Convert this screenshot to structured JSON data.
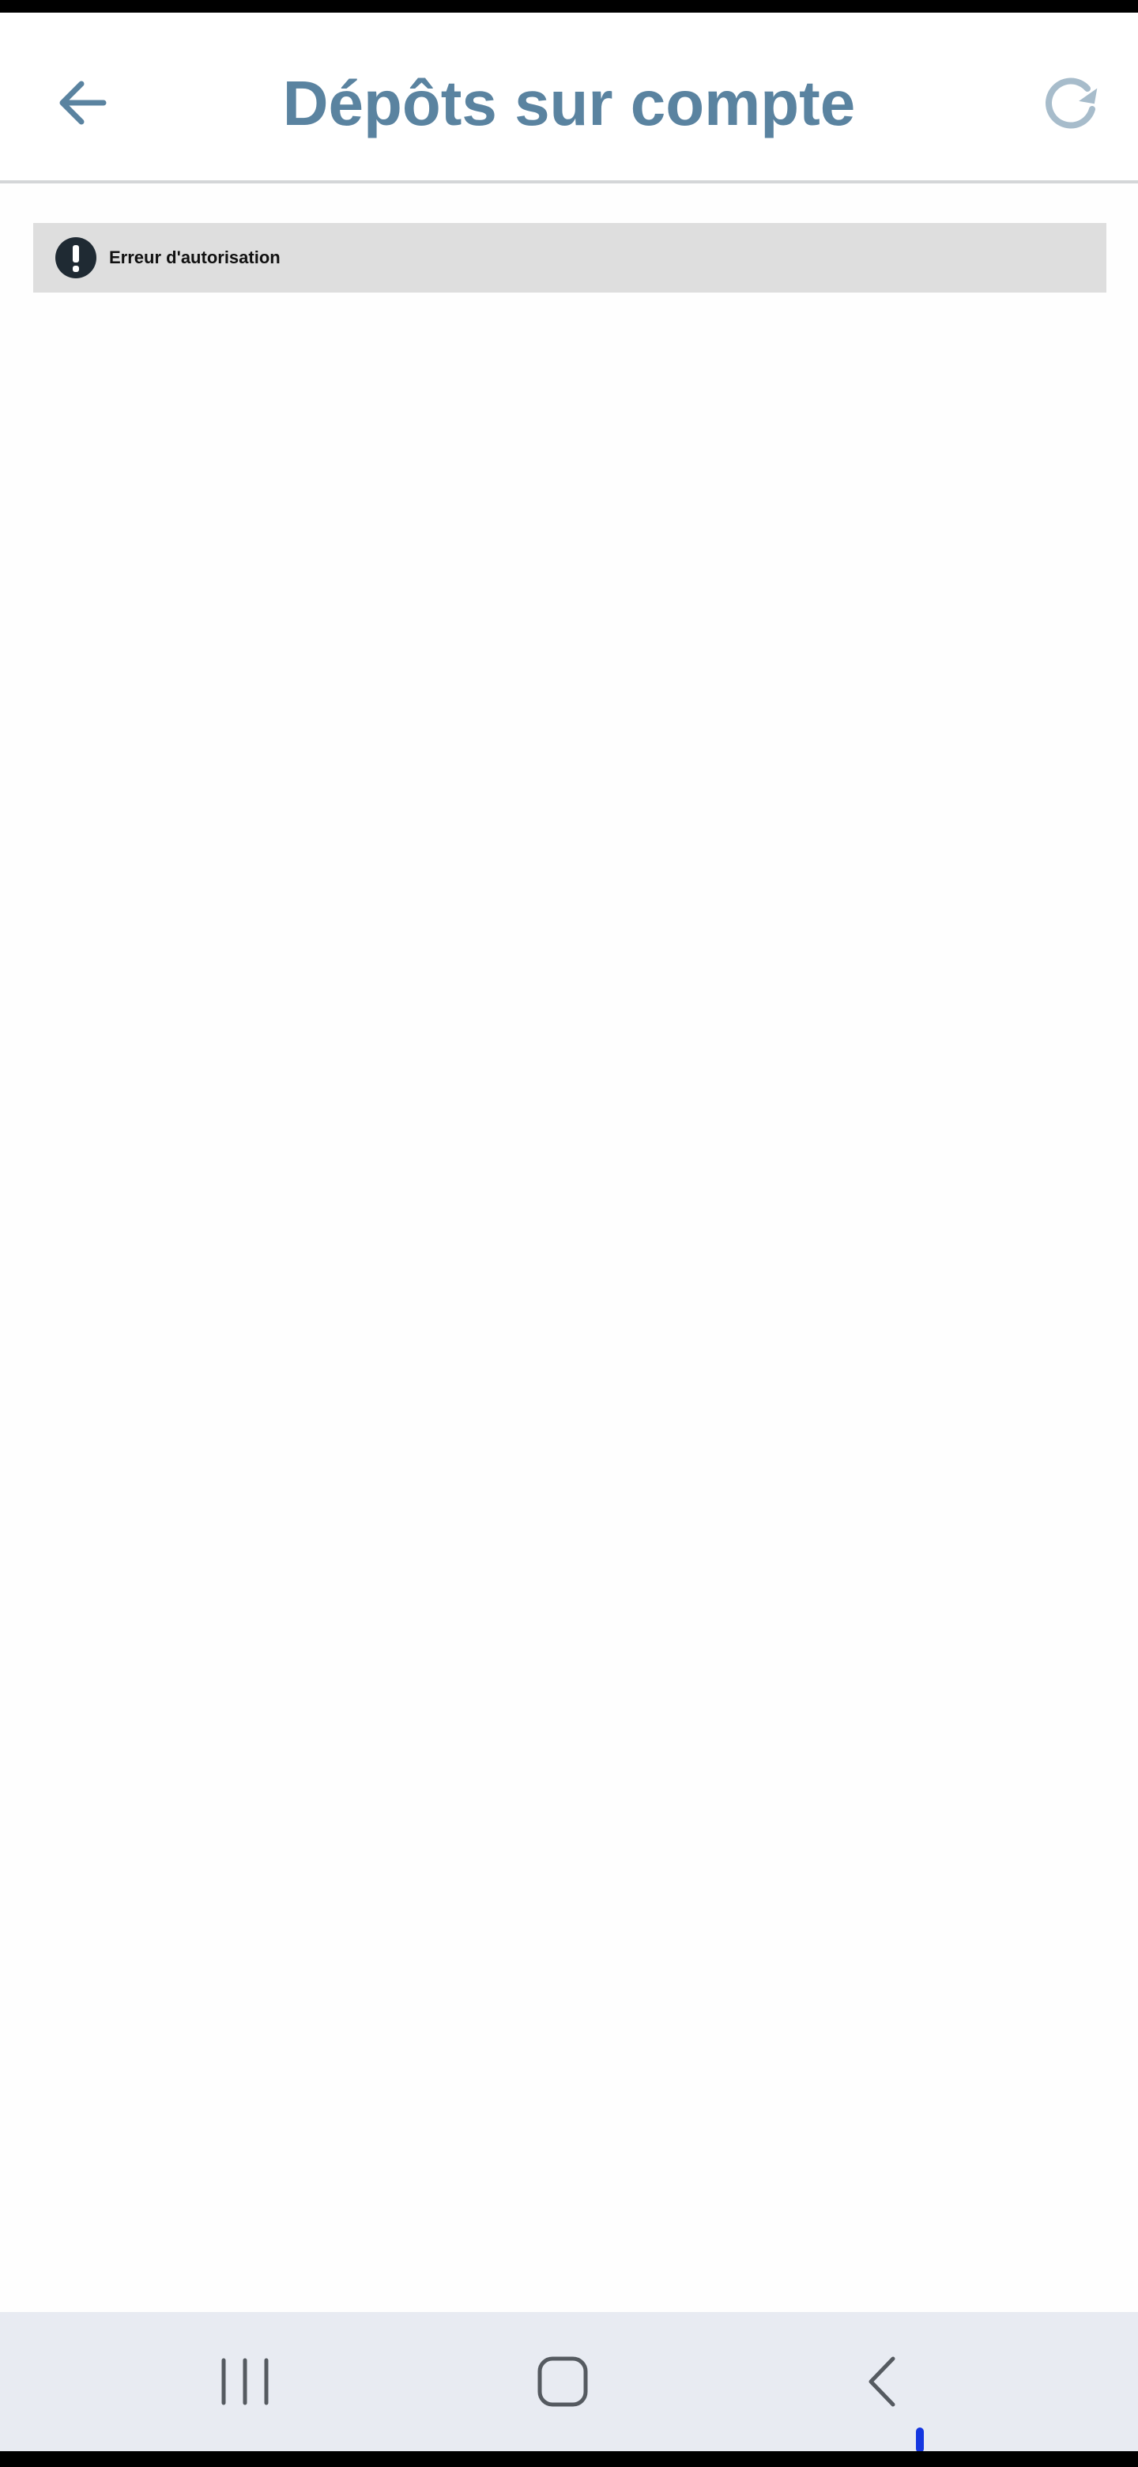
{
  "header": {
    "title": "Dépôts sur compte",
    "back_icon": "arrow-left-icon",
    "refresh_icon": "refresh-icon",
    "accent_color": "#5a83a0"
  },
  "error_banner": {
    "icon": "exclamation-circle-icon",
    "message": "Erreur d'autorisation",
    "background_color": "#dedede"
  },
  "system_nav": {
    "recent_icon": "recent-apps-icon",
    "home_icon": "home-icon",
    "back_icon": "back-chevron-icon"
  }
}
